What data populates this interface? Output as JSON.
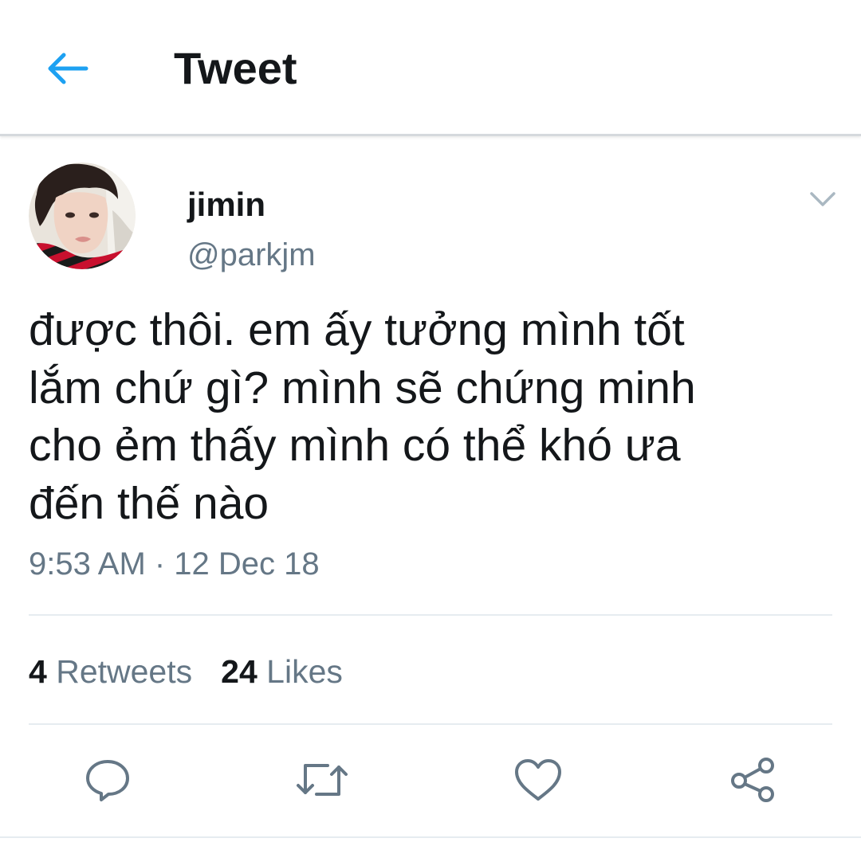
{
  "header": {
    "title": "Tweet",
    "back_icon": "arrow-left-icon"
  },
  "author": {
    "display_name": "jimin",
    "handle": "@parkjm",
    "avatar": "profile-photo"
  },
  "tweet": {
    "text": "được thôi. em ấy tưởng mình tốt\nlắm chứ gì? mình sẽ chứng minh\ncho ẻm thấy mình có thể khó ưa\nđến thế nào",
    "timestamp": "9:53 AM · 12 Dec 18"
  },
  "stats": {
    "retweets_count": "4",
    "retweets_label": "Retweets",
    "likes_count": "24",
    "likes_label": "Likes"
  },
  "actions": {
    "icons": [
      "reply-icon",
      "retweet-icon",
      "like-icon",
      "share-icon"
    ]
  },
  "colors": {
    "accent": "#1da1f2",
    "secondary_text": "#657786",
    "primary_text": "#14171a",
    "icon_gray": "#657786"
  }
}
